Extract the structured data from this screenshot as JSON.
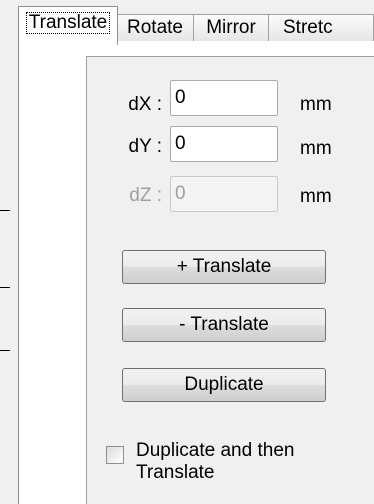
{
  "tabs": [
    {
      "label": "Translate",
      "active": true
    },
    {
      "label": "Rotate",
      "active": false
    },
    {
      "label": "Mirror",
      "active": false
    },
    {
      "label": "Stretc",
      "active": false
    }
  ],
  "fields": {
    "dx": {
      "label": "dX :",
      "value": "0",
      "unit": "mm",
      "enabled": true
    },
    "dy": {
      "label": "dY :",
      "value": "0",
      "unit": "mm",
      "enabled": true
    },
    "dz": {
      "label": "dZ :",
      "value": "0",
      "unit": "mm",
      "enabled": false
    }
  },
  "buttons": {
    "plus_translate": "+ Translate",
    "minus_translate": "- Translate",
    "duplicate": "Duplicate"
  },
  "checkbox": {
    "label_line1": "Duplicate and then",
    "label_line2": "Translate",
    "checked": false
  }
}
